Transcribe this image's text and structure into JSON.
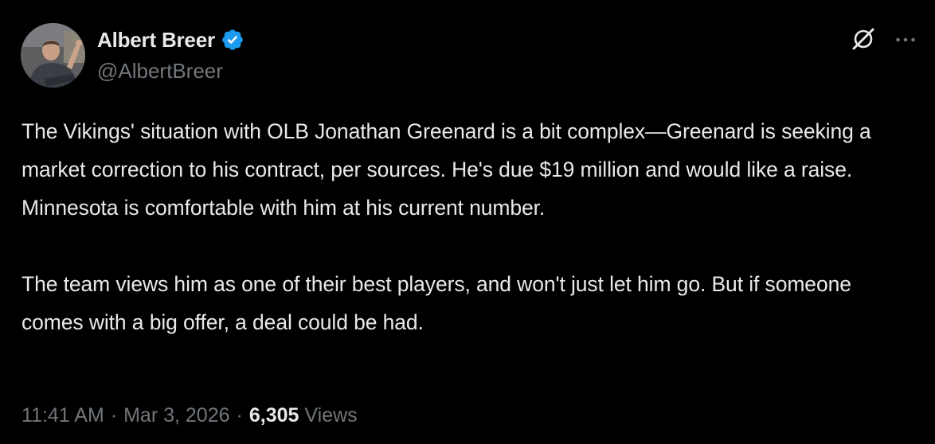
{
  "author": {
    "display_name": "Albert Breer",
    "handle": "@AlbertBreer",
    "verified": true,
    "verified_color": "#1d9bf0",
    "avatar_icon": "profile-photo"
  },
  "actions": {
    "grok_icon": "grok-icon",
    "more_icon": "more-dots-icon"
  },
  "tweet": {
    "paragraphs": [
      "The Vikings' situation with OLB Jonathan Greenard is a bit complex—Greenard is seeking a market correction to his contract, per sources. He's due $19 million and would like a raise. Minnesota is comfortable with him at his current number.",
      "The team views him as one of their best players, and won't just let him go. But if someone comes with a big offer, a deal could be had."
    ]
  },
  "meta": {
    "time": "11:41 AM",
    "separator": "·",
    "date": "Mar 3, 2026",
    "views_count": "6,305",
    "views_label": "Views"
  },
  "colors": {
    "background": "#000000",
    "primary_text": "#e7e9ea",
    "secondary_text": "#71767b"
  }
}
